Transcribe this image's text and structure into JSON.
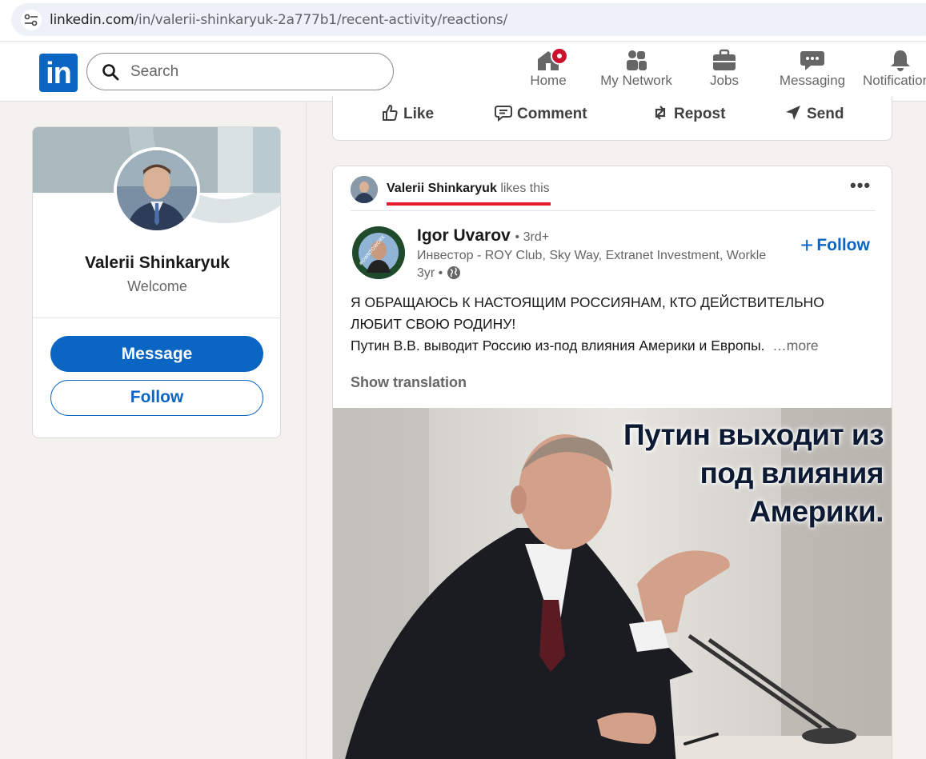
{
  "browser": {
    "url_host": "linkedin.com",
    "url_path": "/in/valerii-shinkaryuk-2a777b1/recent-activity/reactions/"
  },
  "nav": {
    "logo": "in",
    "search_placeholder": "Search",
    "items": [
      {
        "label": "Home",
        "icon": "home-icon"
      },
      {
        "label": "My Network",
        "icon": "network-icon"
      },
      {
        "label": "Jobs",
        "icon": "briefcase-icon"
      },
      {
        "label": "Messaging",
        "icon": "chat-icon"
      },
      {
        "label": "Notifications",
        "icon": "bell-icon"
      }
    ]
  },
  "profile": {
    "name": "Valerii Shinkaryuk",
    "subtitle": "Welcome",
    "message_label": "Message",
    "follow_label": "Follow"
  },
  "prev_post_actions": {
    "like": "Like",
    "comment": "Comment",
    "repost": "Repost",
    "send": "Send"
  },
  "post": {
    "liker_name": "Valerii Shinkaryuk",
    "liker_action": "likes this",
    "more_menu": "•••",
    "author_name": "Igor Uvarov",
    "author_degree": "• 3rd+",
    "author_headline": "Инвестор - ROY Club, Sky Way, Extranet Investment, Workle",
    "post_age": "3yr •",
    "follow_label": "Follow",
    "text_line1": "Я ОБРАЩАЮСЬ К НАСТОЯЩИМ РОССИЯНАМ, КТО ДЕЙСТВИТЕЛЬНО",
    "text_line2": "ЛЮБИТ СВОЮ РОДИНУ!",
    "text_line3": "Путин В.В. выводит Россию из-под влияния Америки и Европы.",
    "more_label": "…more",
    "show_translation": "Show translation",
    "image_caption_line1": "Путин выходит из",
    "image_caption_line2": "под влияния",
    "image_caption_line3": "Америки."
  },
  "colors": {
    "linkedin_blue": "#0a66c2",
    "highlight_red": "#e8192c",
    "notification_red": "#cb112d"
  }
}
